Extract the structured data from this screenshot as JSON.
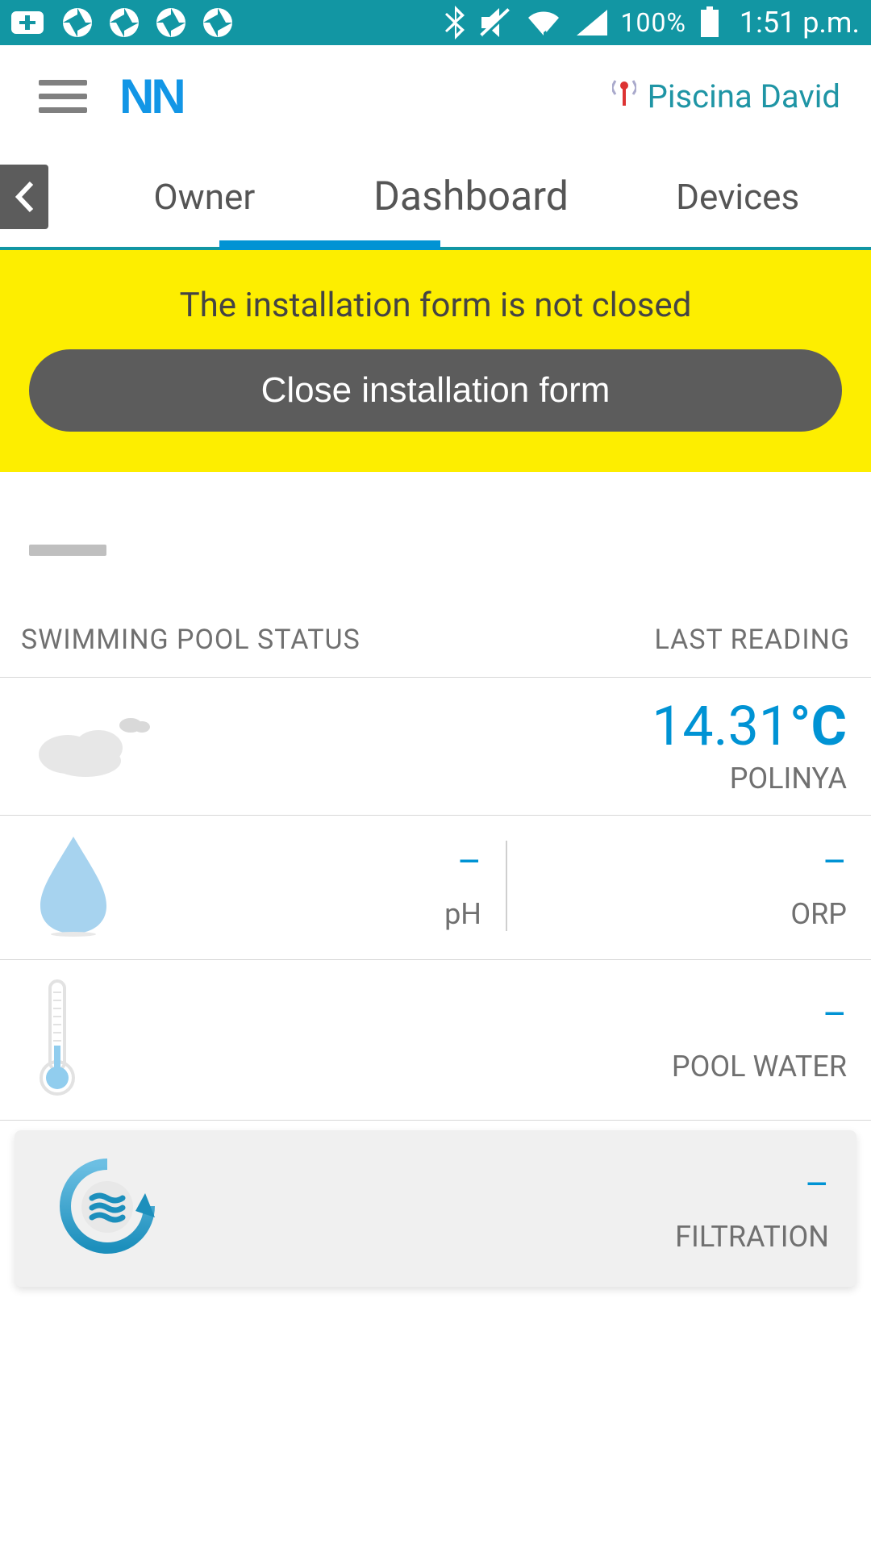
{
  "status_bar": {
    "battery_pct": "100%",
    "time": "1:51 p.m."
  },
  "header": {
    "logo_text": "NN",
    "account_name": "Piscina David"
  },
  "tabs": {
    "owner": "Owner",
    "dashboard": "Dashboard",
    "devices": "Devices"
  },
  "banner": {
    "text": "The installation form is not closed",
    "button": "Close installation form"
  },
  "section": {
    "left": "SWIMMING POOL STATUS",
    "right": "LAST READING"
  },
  "weather": {
    "temp": "14.31",
    "unit": "°C",
    "location": "POLINYA"
  },
  "water_quality": {
    "ph_value": "–",
    "ph_label": "pH",
    "orp_value": "–",
    "orp_label": "ORP"
  },
  "pool_water": {
    "value": "–",
    "label": "POOL WATER"
  },
  "filtration": {
    "value": "–",
    "label": "FILTRATION"
  }
}
